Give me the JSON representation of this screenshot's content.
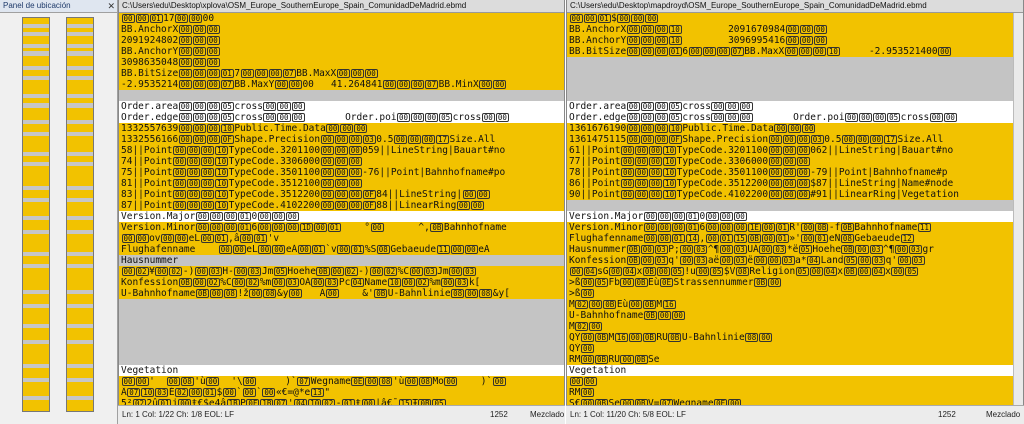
{
  "sidebar": {
    "title": "Panel de ubicación",
    "close": "✕"
  },
  "left_pane": {
    "path": "C:\\Users\\edu\\Desktop\\xplova\\OSM_Europe_SouthernEurope_Spain_ComunidadDeMadrid.ebmd",
    "status": {
      "position": "Ln: 1  Col: 1/22  Ch: 1/8  EOL: LF",
      "number": "1252",
      "mode": "Mezclado"
    }
  },
  "right_pane": {
    "path": "C:\\Users\\edu\\Desktop\\mapdroyd\\OSM_Europe_SouthernEurope_Spain_ComunidadDeMadrid.ebmd",
    "status": {
      "position": "Ln: 1  Col: 11/20  Ch: 5/8  EOL: LF",
      "number": "1252",
      "mode": "Mezclado"
    }
  },
  "left_lines": [
    "[00][00][01]17[00][00]00",
    "BB.AnchorX[00][00][00]",
    "2091924802[00][00][00]",
    "BB.AnchorY[00][00][00]",
    "3098635048[00][00][00]",
    "BB.BitSize[00][00][00][01]7[00][00][00][07]BB.MaxX[00][00][00]",
    "-2.9535214[00][00][00][07]BB.MaxY[00][00]00   41.264841[00][00][00][07]BB.MinX[00][00]",
    "",
    "Order.area[00][00][00][05]cross[00][00][00]",
    "Order.edge[00][00][00][05]cross[00][00][00]       Order.poi[00][00][00][05]cross[00][00]",
    "1332557639[00][00][00][10]Public.Time.Data[00][00][00]",
    "1332556166[00][00][00][0F]Shape.Precision[00][00][00][03]0.5[00][00][00][17]Size.All",
    "58||Point[00][00][00][10]TypeCode.3201100[00][00][00]059||LineString|Bauart#no",
    "74||Point[00][00][00][10]TypeCode.3306000[00][00][00]",
    "75||Point[00][00][00][10]TypeCode.3501100[00][00][00]-76||Point|Bahnhofname#po",
    "81||Point[00][00][00][10]TypeCode.3512100[00][00][00]",
    "83||Point[00][00][00][10]TypeCode.3512200[00][00][00][0F]84||LineString|[00][00]",
    "87||Point[00][00][00][10]TypeCode.4102200[00][00][00][0F]88||LinearRing[00][00]",
    "Version.Major[00][00][00][01]0[00][00][00]",
    "Version.Minor[00][00][00][01]6[00][00][00][1D][00][01]    °[00]      ^,[0B]Bahnhofname",
    "[00][00]ov[00][00]eL[00][01],â[00][01]'v",
    "Flughafenname    [00][00]eL[00][00]eÁ[00][01]`v[00][01]%S[08]Gebaeude[11][00][00]eA",
    "Hausnummer",
    "[00][02]¥[00][02]-)[00][03]H-[00][03]Jm[05]Hoehe[0B][00][02]-)[00][02]%C[00][03]Jm[00][03]",
    "Konfession[0B][00][02]%C[00][02]%m[00][03]OÁ[00][03]Pc[04]Name[10][00][02]%m[00][03]k[",
    "U-Bahnhofname[0B][00][08]!ž[00][08]&y[00]   Á[00]    &'[0B]U-Bahnlinie[08][00][08]&y[",
    "",
    "",
    "",
    "",
    "",
    "",
    "Vegetation",
    "[00][00]'  [00][08]'ù[00]  '\\[00]     )`[07]Wegname[0E][00][08]'ù[00][08]Mo[00]    )`[00]",
    "Â[07][10][03]É[02][00][01]$[00]`[00]`[00]«€=@*e[13]\"",
    "5²[02]2û[01]j[00]ŧ€$e4â[1B]P[0F][1B][07]'[04][10][02]-[01]ŧ[00]|â€¯[15]Ŧ[0B][05]"
  ],
  "right_lines": [
    "[00][00][01]$[00][00][00]",
    "BB.AnchorX[00][00][00][10]        2091670984[00][00][00]",
    "BB.AnchorY[00][00][00][10]        3096995416[00][00][00]",
    "BB.BitSize[00][00][00][01]6[00][00][00][07]BB.MaxX[00][00][00][10]     -2.953521400[00]",
    "",
    "",
    "",
    "",
    "Order.area[00][00][00][05]cross[00][00][00]",
    "Order.edge[00][00][00][05]cross[00][00][00]       Order.poi[00][00][00][05]cross[00][00]",
    "1361676190[00][00][00][10]Public.Time.Data[00][00][00]",
    "1361475115[00][00][00][0F]Shape.Precision[00][00][00][03]0.5[00][00][00][17]Size.All",
    "61||Point[00][00][00][10]TypeCode.3201100[00][00][00]062||LineString|Bauart#no",
    "77||Point[00][00][00][10]TypeCode.3306000[00][00][00]",
    "78||Point[00][00][00][10]TypeCode.3501100[00][00][00]-79||Point|Bahnhofname#p",
    "86||Point[00][00][00][10]TypeCode.3512200[00][00][00]$87||LineString|Name#node",
    "90||Point[00][00][00][10]TypeCode.4102200[00][00][00]#91||LinearRing|Vegetation",
    "",
    "Version.Major[00][00][00][01]0[00][00][00]",
    "Version.Minor[00][00][00][01]6[00][00][00][1E][00][01]R'[00][0B]-f[0B]Bahnhofname[11]",
    "Flughafenname[00][00][01][14],[00][01][15][0B][00][01]»'[00][01]eÑ[08]Gebaeude[12]",
    "Hausnummer[0B][00][03]P;[00][03]^¶[00][03]UÁ[00][03]*ë[05]Hoehe[0B][00][03]^¶[00][03]gr",
    "Konfession[0B][00][03]q'[00][03]aë[00][03]ë[00][00][03]a*[04]Land[05][00][03]q'[00][03]",
    "[00][04]sG[00][04]x[0B][00][05]!u[00][05]$V[08]Religion[05][00][04]x[0B][00][04]x[00][05]",
    ">ß[00][05]Fb[00][0B]Eù[0E]Strassennummer[0B][00]",
    ">ß[00]",
    "M[02][00][0B]Eù[00][0B]M[16]",
    "U-Bahnhofname[0B][00][00]",
    "M[02][00]",
    "QÝ[00][0B]M[16][00][0B]RÚ[0B]U-Bahnlinie[08][00]",
    "QÝ[00]",
    "RM[00][0B]RÚ[00][0B]Se",
    "Vegetation",
    "[00][00]",
    "RM[00]",
    "S€[00][0B]Se[00][0B]V=[07]Wegname[0E][00]"
  ]
}
